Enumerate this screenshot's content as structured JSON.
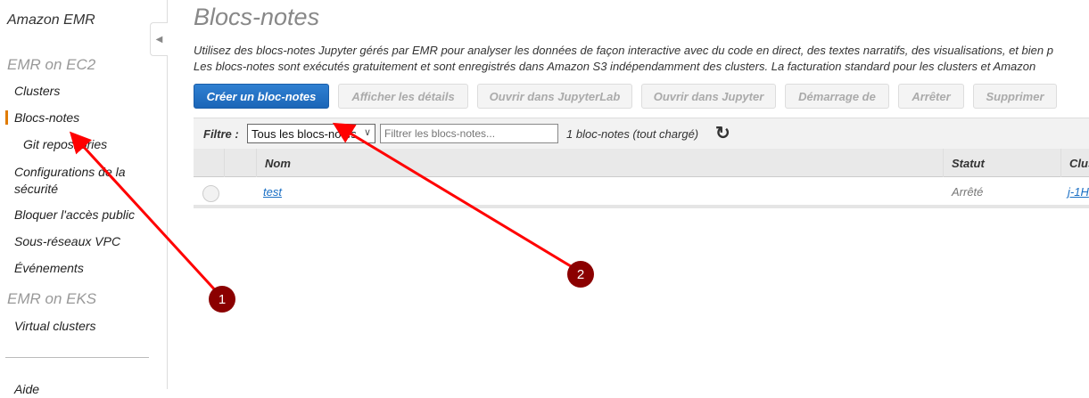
{
  "sidebar": {
    "brand": "Amazon EMR",
    "section_ec2": "EMR on EC2",
    "items": [
      {
        "label": "Clusters"
      },
      {
        "label": "Blocs-notes"
      },
      {
        "label": "Git repositories"
      },
      {
        "label": "Configurations de la sécurité"
      },
      {
        "label": "Bloquer l'accès public"
      },
      {
        "label": "Sous-réseaux VPC"
      },
      {
        "label": "Événements"
      }
    ],
    "section_eks": "EMR on EKS",
    "eks_items": [
      {
        "label": "Virtual clusters"
      }
    ],
    "help": "Aide"
  },
  "main": {
    "title": "Blocs-notes",
    "description": [
      "Utilisez des blocs-notes Jupyter gérés par EMR pour analyser les données de façon interactive avec du code en direct, des textes narratifs, des visualisations, et bien p",
      "Les blocs-notes sont exécutés gratuitement et sont enregistrés dans Amazon S3 indépendamment des clusters. La facturation standard pour les clusters et Amazon"
    ],
    "buttons": {
      "create": "Créer un bloc-notes",
      "details": "Afficher les détails",
      "jupyterlab": "Ouvrir dans JupyterLab",
      "jupyter": "Ouvrir dans Jupyter",
      "start": "Démarrage de",
      "stop": "Arrêter",
      "delete": "Supprimer"
    },
    "filter": {
      "label": "Filtre :",
      "selected": "Tous les blocs-notes",
      "placeholder": "Filtrer les blocs-notes...",
      "count": "1 bloc-notes (tout chargé)"
    },
    "table": {
      "headers": {
        "name": "Nom",
        "status": "Statut",
        "cluster": "Clus"
      },
      "rows": [
        {
          "name": "test",
          "status": "Arrêté",
          "cluster": "j-1H"
        }
      ]
    }
  },
  "annotations": [
    {
      "label": "1"
    },
    {
      "label": "2"
    }
  ],
  "colors": {
    "primary": "#1b66b8",
    "active": "#e07b00",
    "arrow": "#ff0000",
    "marker": "#8b0000"
  }
}
